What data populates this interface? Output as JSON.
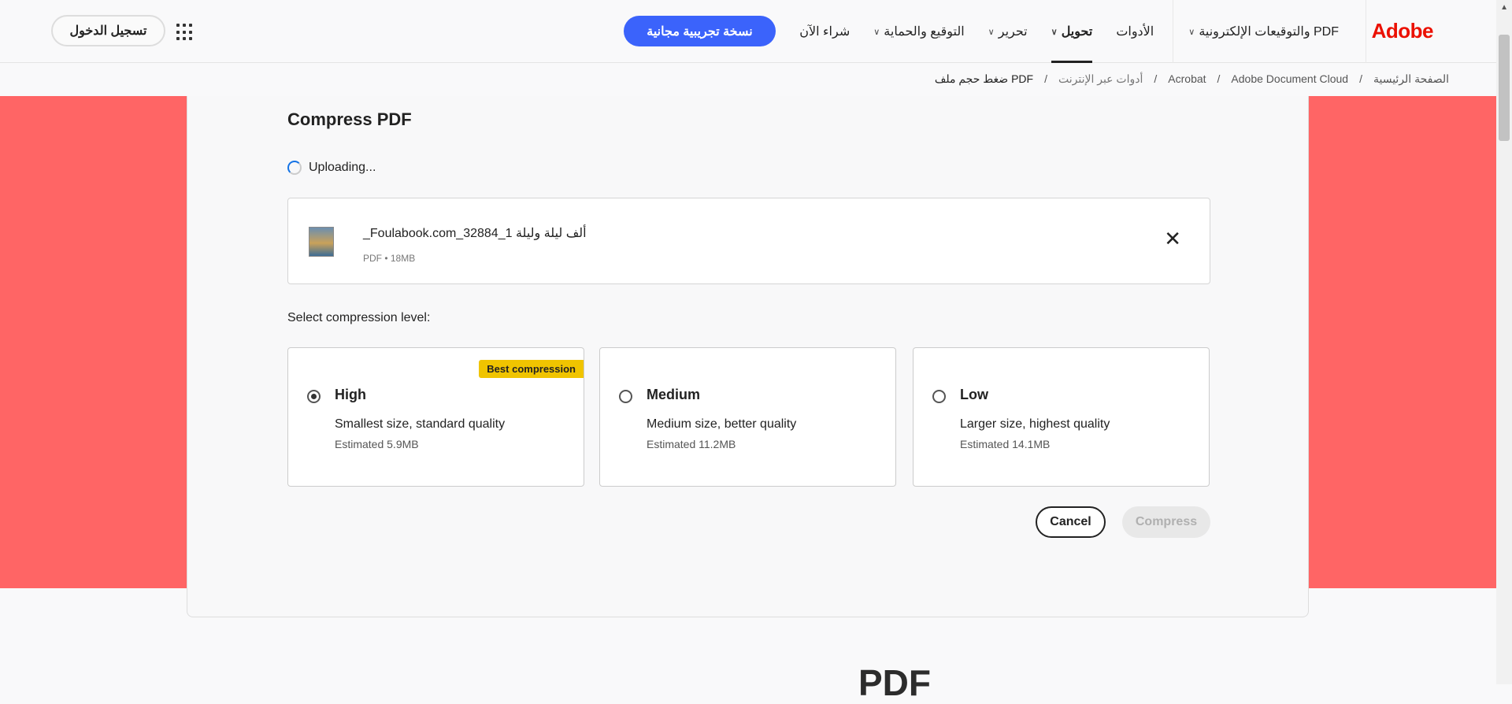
{
  "header": {
    "logo": "Adobe",
    "nav": [
      {
        "label": "PDF والتوقيعات الإلكترونية",
        "chevron": true
      },
      {
        "label": "الأدوات",
        "chevron": false
      },
      {
        "label": "تحويل",
        "chevron": true,
        "active": true
      },
      {
        "label": "تحرير",
        "chevron": true
      },
      {
        "label": "التوقيع والحماية",
        "chevron": true
      },
      {
        "label": "شراء الآن",
        "chevron": false
      }
    ],
    "trial_button": "نسخة تجريبية مجانية",
    "login_button": "تسجيل الدخول"
  },
  "breadcrumb": [
    "الصفحة الرئيسية",
    "Adobe Document Cloud",
    "Acrobat",
    "أدوات عبر الإنترنت",
    "ضغط حجم ملف PDF"
  ],
  "breadcrumb_sep": "/",
  "card": {
    "title": "Compress PDF",
    "status": "Uploading...",
    "file": {
      "name": "_Foulabook.com_ألف ليلة وليلة 1_32884",
      "meta": "PDF • 18MB"
    },
    "select_label": "Select compression level:",
    "options": [
      {
        "name": "High",
        "desc": "Smallest size, standard quality",
        "estimate": "Estimated 5.9MB",
        "badge": "Best compression",
        "selected": true
      },
      {
        "name": "Medium",
        "desc": "Medium size, better quality",
        "estimate": "Estimated 11.2MB",
        "selected": false
      },
      {
        "name": "Low",
        "desc": "Larger size, highest quality",
        "estimate": "Estimated 14.1MB",
        "selected": false
      }
    ],
    "cancel": "Cancel",
    "compress": "Compress"
  },
  "bottom_heading": "PDF"
}
